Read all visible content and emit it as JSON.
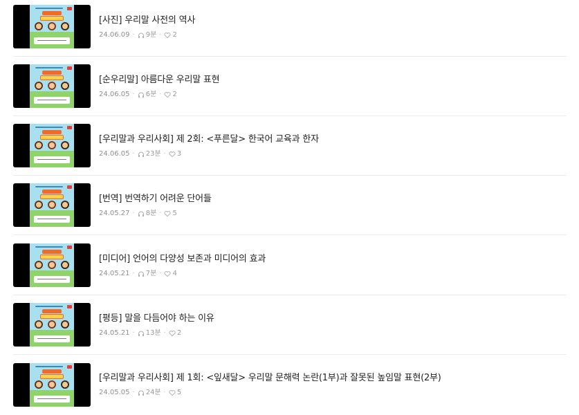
{
  "items": [
    {
      "title": "[사진] 우리말 사전의 역사",
      "date": "24.06.09",
      "duration": "9분",
      "likes": "2"
    },
    {
      "title": "[순우리말] 아름다운 우리말 표현",
      "date": "24.06.05",
      "duration": "6분",
      "likes": "2"
    },
    {
      "title": "[우리말과 우리사회] 제 2회: <푸른달> 한국어 교육과 한자",
      "date": "24.06.05",
      "duration": "23분",
      "likes": "3"
    },
    {
      "title": "[번역] 번역하기 어려운 단어들",
      "date": "24.05.27",
      "duration": "8분",
      "likes": "5"
    },
    {
      "title": "[미디어] 언어의 다양성 보존과 미디어의 효과",
      "date": "24.05.21",
      "duration": "7분",
      "likes": "4"
    },
    {
      "title": "[평등] 말을 다듬어야 하는 이유",
      "date": "24.05.21",
      "duration": "13분",
      "likes": "2"
    },
    {
      "title": "[우리말과 우리사회] 제 1회: <잎새달> 우리말 문해력 논란(1부)과 잘못된 높임말 표현(2부)",
      "date": "24.05.05",
      "duration": "24분",
      "likes": "5"
    }
  ],
  "meta_separator": "·",
  "icons": {
    "duration": "headphones-icon",
    "likes": "heart-icon"
  }
}
